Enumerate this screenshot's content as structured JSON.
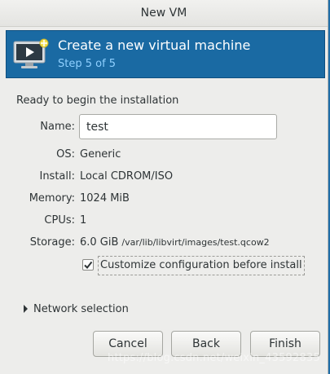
{
  "window": {
    "title": "New VM"
  },
  "banner": {
    "title": "Create a new virtual machine",
    "step": "Step 5 of 5",
    "icon": "vm-monitor-icon"
  },
  "summary": {
    "heading": "Ready to begin the installation",
    "name_label": "Name:",
    "name_value": "test",
    "os_label": "OS:",
    "os_value": "Generic",
    "install_label": "Install:",
    "install_value": "Local CDROM/ISO",
    "memory_label": "Memory:",
    "memory_value": "1024 MiB",
    "cpus_label": "CPUs:",
    "cpus_value": "1",
    "storage_label": "Storage:",
    "storage_size": "6.0 GiB",
    "storage_path": "/var/lib/libvirt/images/test.qcow2"
  },
  "customize": {
    "label": "Customize configuration before install",
    "checked": true
  },
  "network": {
    "label": "Network selection",
    "expanded": false
  },
  "buttons": {
    "cancel": "Cancel",
    "back": "Back",
    "finish": "Finish"
  },
  "watermark": "https://blog.csdn.net/weixin_43592835",
  "colors": {
    "banner": "#1a6aa3",
    "step_text": "#8fd0ff",
    "window_bg": "#ededeb",
    "desktop": "#1f6ea8"
  }
}
